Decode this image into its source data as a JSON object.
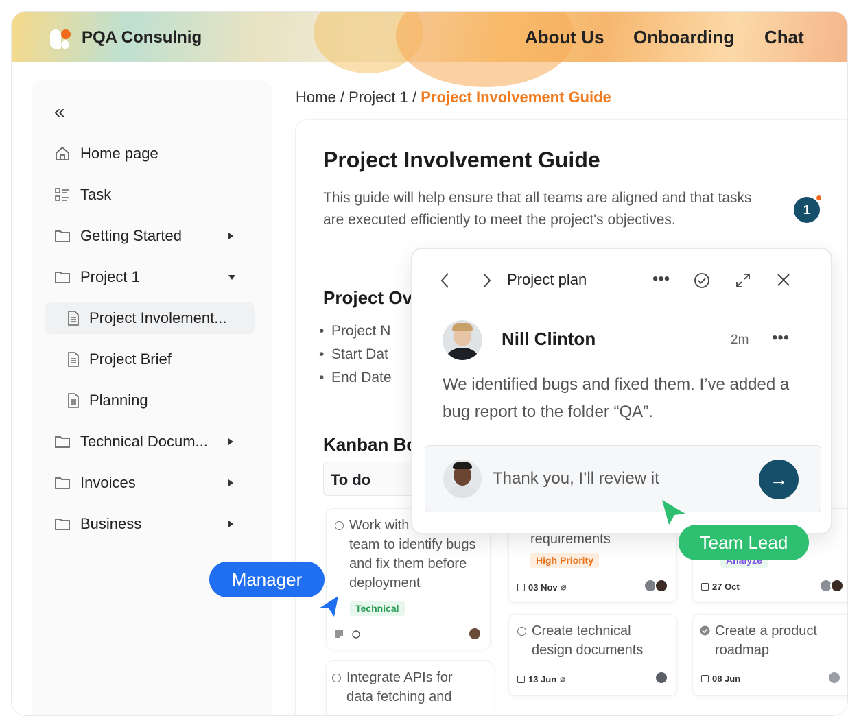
{
  "header": {
    "brand": "PQA Consulnig",
    "nav": [
      "About Us",
      "Onboarding",
      "Chat"
    ]
  },
  "sidebar": {
    "collapse_icon": "double-chevron-left-icon",
    "items": [
      {
        "label": "Home page",
        "icon": "home-icon"
      },
      {
        "label": "Task",
        "icon": "task-list-icon"
      },
      {
        "label": "Getting Started",
        "icon": "folder-icon"
      },
      {
        "label": "Project 1",
        "icon": "folder-icon"
      },
      {
        "label": "Project Involement...",
        "icon": "document-icon"
      },
      {
        "label": "Project Brief",
        "icon": "document-icon"
      },
      {
        "label": "Planning",
        "icon": "document-icon"
      },
      {
        "label": "Technical Docum...",
        "icon": "folder-icon"
      },
      {
        "label": "Invoices",
        "icon": "folder-icon"
      },
      {
        "label": "Business",
        "icon": "folder-icon"
      }
    ]
  },
  "breadcrumb": {
    "home": "Home",
    "sep": "/",
    "project": "Project 1",
    "current": "Project Involvement Guide"
  },
  "page": {
    "title": "Project Involvement Guide",
    "description": "This guide will help ensure that all teams are aligned and that tasks are executed efficiently to meet the project's objectives.",
    "comment_count": "1",
    "overview_title": "Project Ov",
    "overview_bullets": [
      "Project N",
      "Start Dat",
      "End Date"
    ],
    "kanban_title": "Kanban Bo",
    "column_todo": "To do"
  },
  "cards": {
    "c1": {
      "text": "Work with team to identify bugs and fix them before deployment",
      "line1": "Work with",
      "rest": "team to identify bugs and fix them before deployment",
      "tag": "Technical"
    },
    "c2": {
      "text": "requirements",
      "tag": "High Priority",
      "date": "03 Nov"
    },
    "c3": {
      "tag": "Analyze",
      "date": "27 Oct"
    },
    "c4": {
      "text": "Integrate APIs for data fetching and",
      "line1": "Integrate APIs for",
      "line2": "data fetching and"
    },
    "c5": {
      "line1": "Create technical",
      "line2": "design documents",
      "date": "13 Jun"
    },
    "c6": {
      "line1": "Create a product",
      "line2": "roadmap",
      "date": "08 Jun"
    }
  },
  "popup": {
    "title": "Project plan",
    "user": "Nill Clinton",
    "time": "2m",
    "message": "We identified bugs and fixed them. I’ve added a bug report to the folder “QA”.",
    "reply_value": "Thank you, I’ll review it"
  },
  "labels": {
    "manager": "Manager",
    "team_lead": "Team Lead"
  },
  "colors": {
    "accent": "#f07a1e",
    "primary": "#164f6a",
    "manager": "#1f6ff0",
    "team_lead": "#2fbf71"
  }
}
